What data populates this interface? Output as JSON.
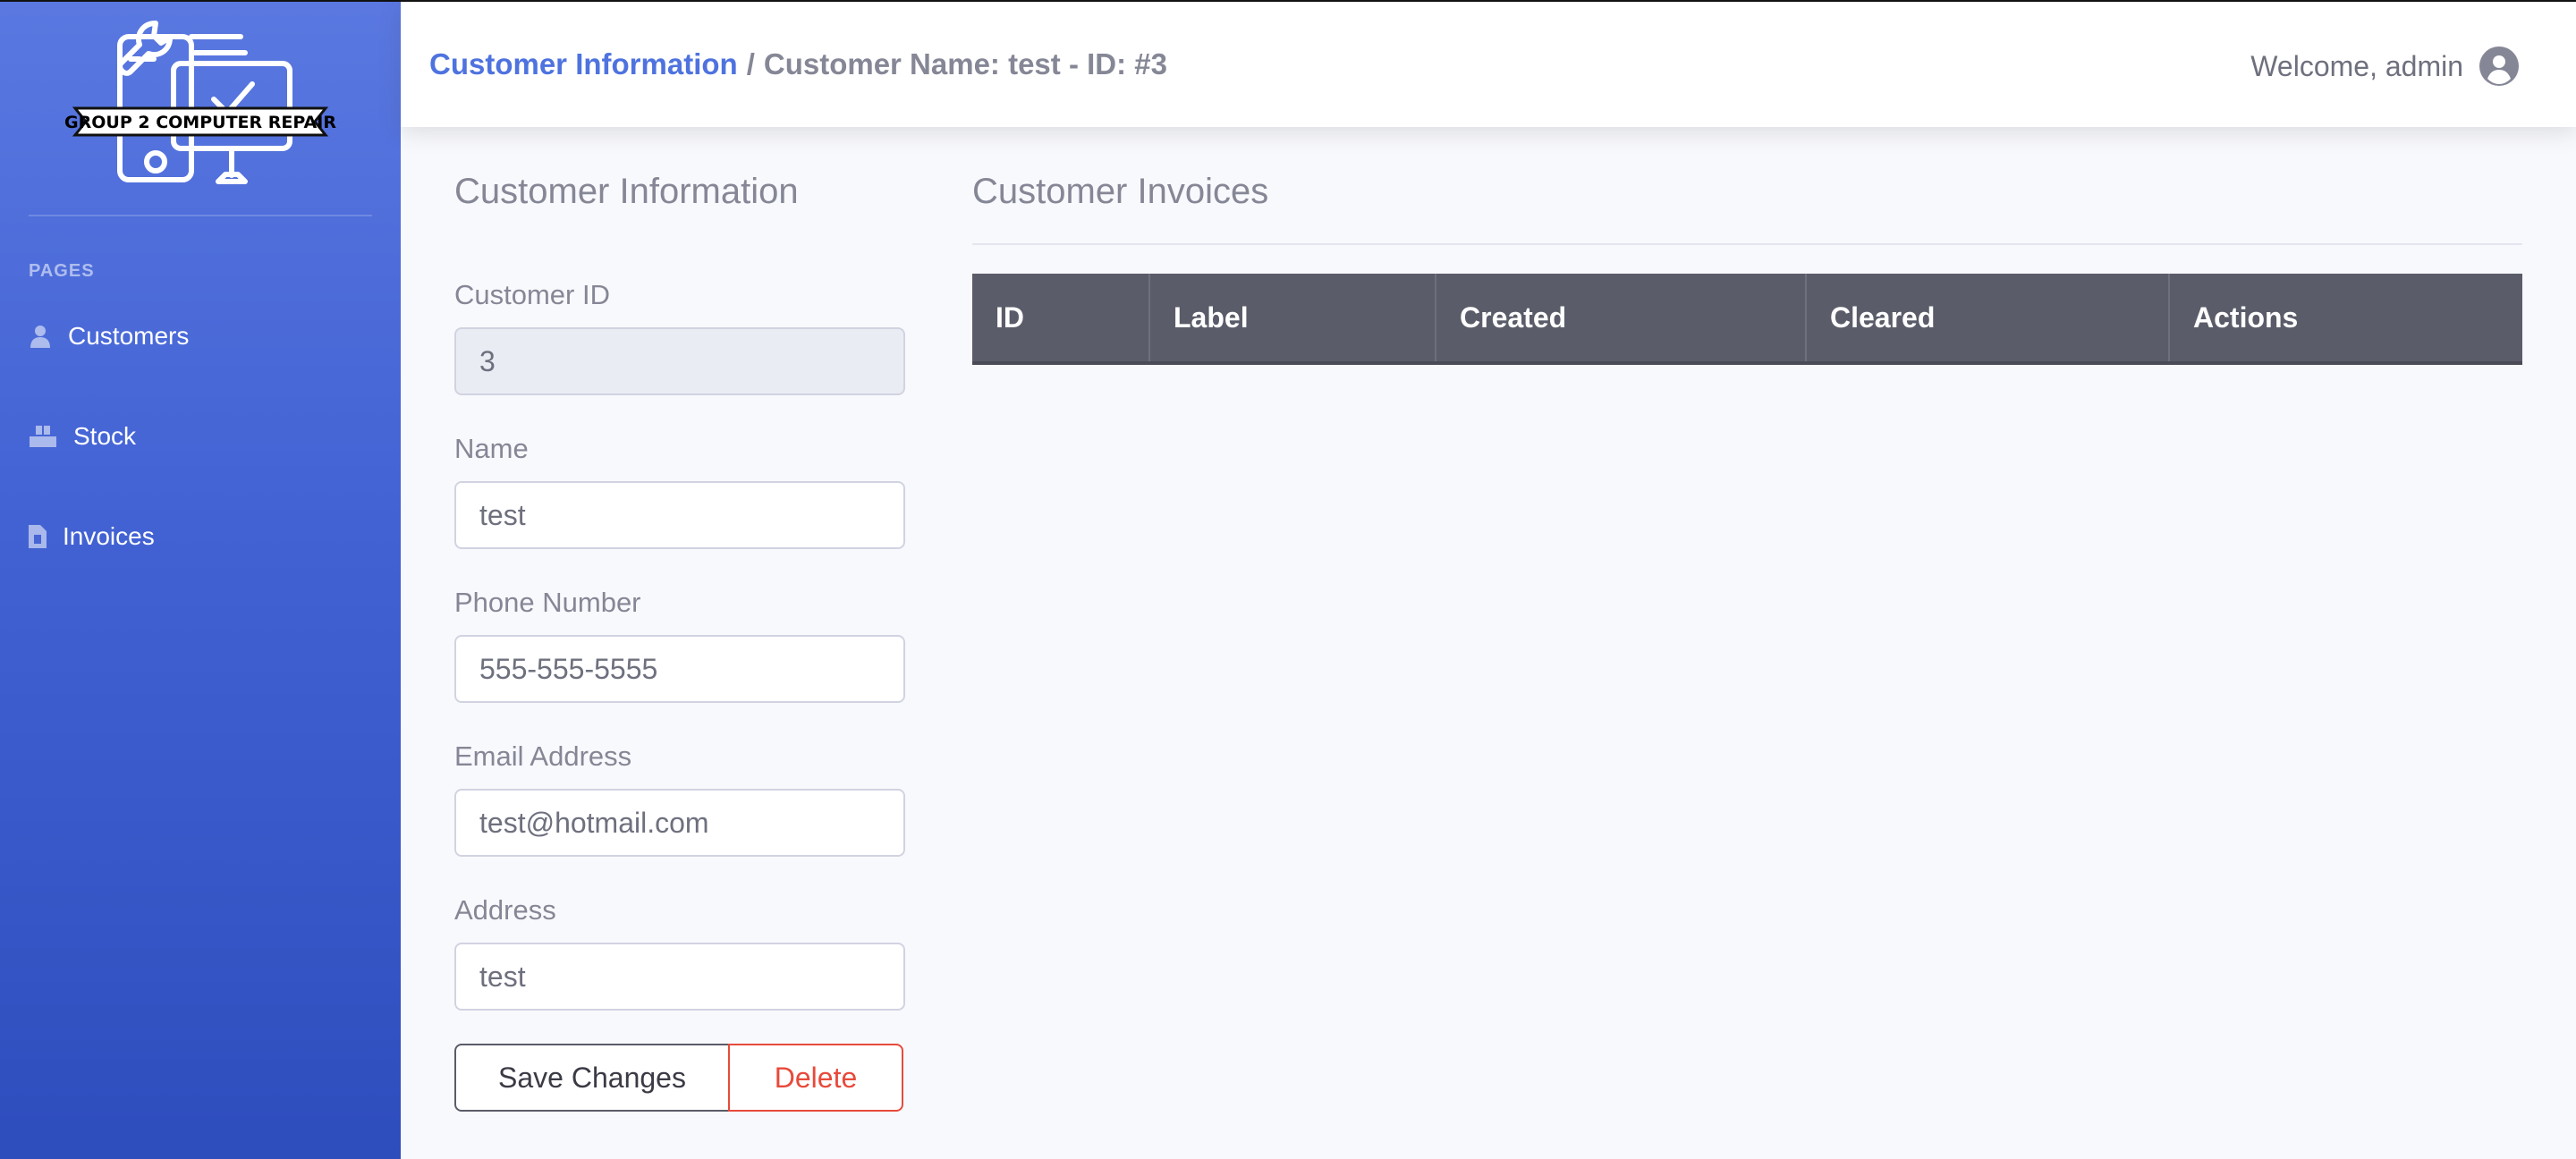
{
  "brand": {
    "logo_text": "GROUP 2 COMPUTER REPAIR"
  },
  "sidebar": {
    "heading": "PAGES",
    "items": [
      {
        "label": "Customers",
        "icon": "user-icon"
      },
      {
        "label": "Stock",
        "icon": "boxes-icon"
      },
      {
        "label": "Invoices",
        "icon": "invoice-icon"
      }
    ]
  },
  "topbar": {
    "breadcrumb_link": "Customer Information",
    "breadcrumb_sep": "/",
    "breadcrumb_current": "Customer Name: test - ID: #3",
    "welcome": "Welcome, admin",
    "avatar_icon": "user-circle-icon"
  },
  "customer": {
    "title": "Customer Information",
    "fields": [
      {
        "label": "Customer ID",
        "value": "3",
        "readonly": true
      },
      {
        "label": "Name",
        "value": "test"
      },
      {
        "label": "Phone Number",
        "value": "555-555-5555"
      },
      {
        "label": "Email Address",
        "value": "test@hotmail.com"
      },
      {
        "label": "Address",
        "value": "test"
      }
    ],
    "save_label": "Save Changes",
    "delete_label": "Delete"
  },
  "invoices": {
    "title": "Customer Invoices",
    "columns": [
      "ID",
      "Label",
      "Created",
      "Cleared",
      "Actions"
    ],
    "rows": []
  },
  "colors": {
    "accent": "#4e73df",
    "danger": "#e74a3b",
    "table_header": "#5a5c69"
  }
}
